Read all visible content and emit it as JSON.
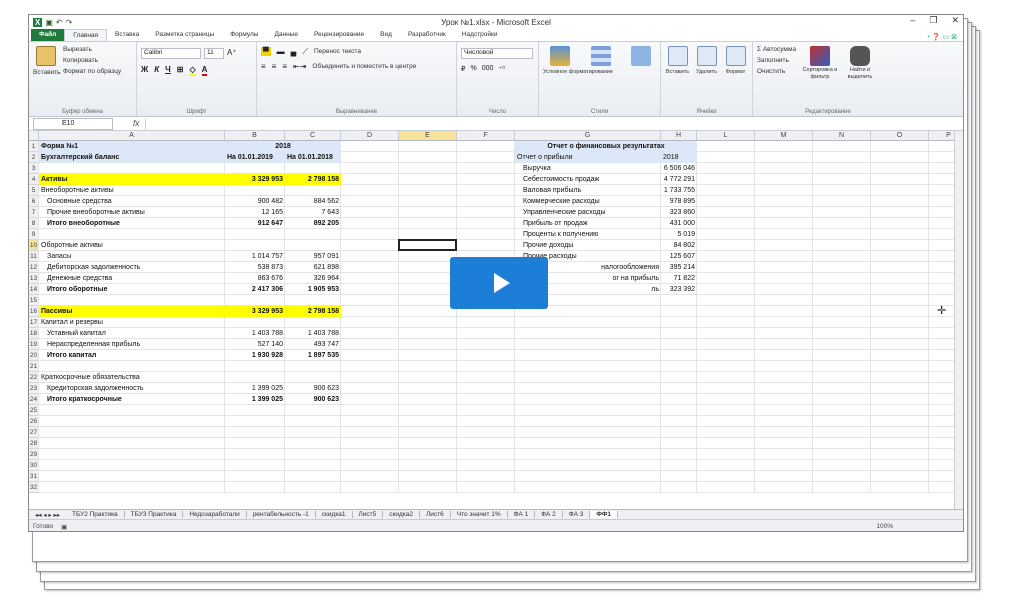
{
  "window": {
    "title": "Урок №1.xlsx - Microsoft Excel"
  },
  "tabs": [
    "Файл",
    "Главная",
    "Вставка",
    "Разметка страницы",
    "Формулы",
    "Данные",
    "Рецензирование",
    "Вид",
    "Разработчик",
    "Надстройки"
  ],
  "ribbon": {
    "clipboard": {
      "paste": "Вставить",
      "cut": "Вырезать",
      "copy": "Копировать",
      "format": "Формат по образцу",
      "label": "Буфер обмена"
    },
    "font": {
      "name": "Calibri",
      "size": "11",
      "label": "Шрифт"
    },
    "align": {
      "wrap": "Перенос текста",
      "merge": "Объединить и поместить в центре",
      "label": "Выравнивание"
    },
    "number": {
      "format": "Числовой",
      "label": "Число"
    },
    "styles": {
      "cond": "Условное форматирование",
      "table": "Форматировать как таблицу",
      "cells": "Стили ячеек",
      "label": "Стили"
    },
    "cells": {
      "insert": "Вставить",
      "delete": "Удалить",
      "format": "Формат",
      "label": "Ячейки"
    },
    "editing": {
      "autosum": "Автосумма",
      "fill": "Заполнить",
      "clear": "Очистить",
      "sort": "Сортировка и фильтр",
      "find": "Найти и выделить",
      "label": "Редактирование"
    }
  },
  "namebox": "E10",
  "fx": "fx",
  "columns": [
    "A",
    "B",
    "C",
    "D",
    "E",
    "F",
    "G",
    "H",
    "L",
    "M",
    "N",
    "O",
    "P"
  ],
  "rows": [
    "1",
    "2",
    "3",
    "4",
    "5",
    "6",
    "7",
    "8",
    "9",
    "10",
    "11",
    "12",
    "13",
    "14",
    "15",
    "16",
    "17",
    "18",
    "19",
    "20",
    "21",
    "22",
    "23",
    "24",
    "25",
    "26",
    "27",
    "28",
    "29",
    "30",
    "31",
    "32"
  ],
  "left_table": [
    [
      "Форма №1",
      "2018",
      ""
    ],
    [
      "Бухгалтерский баланс",
      "На 01.01.2019",
      "На 01.01.2018"
    ],
    [
      "",
      "",
      ""
    ],
    [
      "Активы",
      "3 329 953",
      "2 798 158"
    ],
    [
      "Внеоборотные активы",
      "",
      ""
    ],
    [
      "Основные средства",
      "900 482",
      "884 562"
    ],
    [
      "Прочие внеоборотные активы",
      "12 165",
      "7 643"
    ],
    [
      "Итого внеоборотные",
      "912 647",
      "892 205"
    ],
    [
      "",
      "",
      ""
    ],
    [
      "Оборотные активы",
      "",
      ""
    ],
    [
      "Запасы",
      "1 014 757",
      "957 091"
    ],
    [
      "Дебиторская задолженность",
      "538 873",
      "621 898"
    ],
    [
      "Денежные средства",
      "863 676",
      "326 964"
    ],
    [
      "Итого оборотные",
      "2 417 306",
      "1 905 953"
    ],
    [
      "",
      "",
      ""
    ],
    [
      "Пассивы",
      "3 329 953",
      "2 798 158"
    ],
    [
      "Капитал и резервы",
      "",
      ""
    ],
    [
      "Уставный капитал",
      "1 403 788",
      "1 403 788"
    ],
    [
      "Нераспределенная прибыль",
      "527 140",
      "493 747"
    ],
    [
      "Итого капитал",
      "1 930 928",
      "1 897 535"
    ],
    [
      "",
      "",
      ""
    ],
    [
      "Краткосрочные обязательства",
      "",
      ""
    ],
    [
      "Кредиторская задолженность",
      "1 399 025",
      "900 623"
    ],
    [
      "Итого краткосрочные",
      "1 399 025",
      "900 623"
    ]
  ],
  "right_table": [
    [
      "Отчет о финансовых результатах",
      ""
    ],
    [
      "Отчет о прибыли",
      "2018"
    ],
    [
      "Выручка",
      "6 506 046"
    ],
    [
      "Себестоимость продаж",
      "4 772 291"
    ],
    [
      "Валовая прибыль",
      "1 733 755"
    ],
    [
      "Коммерческие расходы",
      "978 895"
    ],
    [
      "Управленческие расходы",
      "323 860"
    ],
    [
      "Прибыль от продаж",
      "431 000"
    ],
    [
      "Проценты к получению",
      "5 019"
    ],
    [
      "Прочие доходы",
      "84 802"
    ],
    [
      "Прочие расходы",
      "125 607"
    ],
    [
      "налогообложения",
      "395 214"
    ],
    [
      "ог на прибыль",
      "71 822"
    ],
    [
      "ль",
      "323 392"
    ]
  ],
  "sheet_tabs": [
    "ТБУ2 Практика",
    "ТБУ3 Практика",
    "Недозаработали",
    "рентабельность -1",
    "скидка1",
    "Лист5",
    "скидка2",
    "Лист6",
    "Что значит 1%",
    "ФА 1",
    "ФА 2",
    "ФА 3",
    "ФФ1"
  ],
  "status": {
    "ready": "Готово",
    "zoom": "100%"
  }
}
